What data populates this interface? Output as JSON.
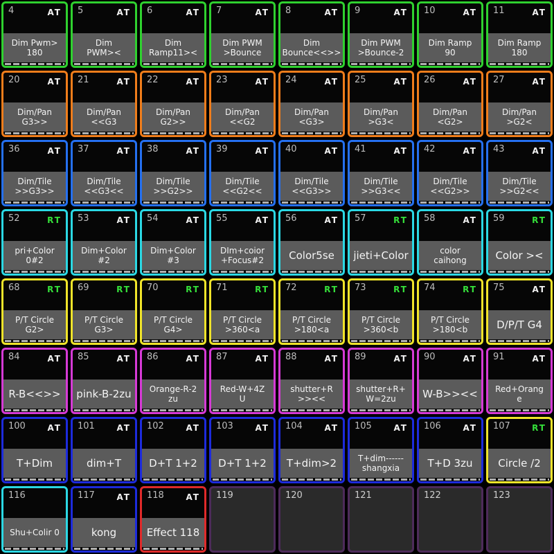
{
  "colors": {
    "green": "#2fd12f",
    "orange": "#f07d1b",
    "blue": "#2570f0",
    "cyan": "#2bd8e4",
    "yellow": "#f0e42a",
    "magenta": "#d63ad6",
    "deepblue": "#1d2bdc",
    "red": "#e02a2a",
    "empty": "#4d2b5a"
  },
  "rows": [
    {
      "color": "green",
      "cells": [
        {
          "num": "4",
          "mode": "AT",
          "label": "Dim Pwm>\n180"
        },
        {
          "num": "5",
          "mode": "AT",
          "label": "Dim\nPWM><"
        },
        {
          "num": "6",
          "mode": "AT",
          "label": "Dim\nRamp11><"
        },
        {
          "num": "7",
          "mode": "AT",
          "label": "Dim PWM\n>Bounce"
        },
        {
          "num": "8",
          "mode": "AT",
          "label": "Dim\nBounce<<>>"
        },
        {
          "num": "9",
          "mode": "AT",
          "label": "Dim PWM\n>Bounce-2"
        },
        {
          "num": "10",
          "mode": "AT",
          "label": "Dim Ramp\n90"
        },
        {
          "num": "11",
          "mode": "AT",
          "label": "Dim Ramp\n180"
        }
      ]
    },
    {
      "color": "orange",
      "cells": [
        {
          "num": "20",
          "mode": "AT",
          "label": "Dim/Pan\nG3>>"
        },
        {
          "num": "21",
          "mode": "AT",
          "label": "Dim/Pan\n<<G3"
        },
        {
          "num": "22",
          "mode": "AT",
          "label": "Dim/Pan\nG2>>"
        },
        {
          "num": "23",
          "mode": "AT",
          "label": "Dim/Pan\n<<G2"
        },
        {
          "num": "24",
          "mode": "AT",
          "label": "Dim/Pan\n<G3>"
        },
        {
          "num": "25",
          "mode": "AT",
          "label": "Dim/Pan\n>G3<"
        },
        {
          "num": "26",
          "mode": "AT",
          "label": "Dim/Pan\n<G2>"
        },
        {
          "num": "27",
          "mode": "AT",
          "label": "Dim/Pan\n>G2<"
        }
      ]
    },
    {
      "color": "blue",
      "cells": [
        {
          "num": "36",
          "mode": "AT",
          "label": "Dim/Tile\n>>G3>>"
        },
        {
          "num": "37",
          "mode": "AT",
          "label": "Dim/Tile\n<<G3<<"
        },
        {
          "num": "38",
          "mode": "AT",
          "label": "Dim/Tile\n>>G2>>"
        },
        {
          "num": "39",
          "mode": "AT",
          "label": "Dim/Tile\n<<G2<<"
        },
        {
          "num": "40",
          "mode": "AT",
          "label": "Dim/Tile\n<<G3>>"
        },
        {
          "num": "41",
          "mode": "AT",
          "label": "Dim/Tile\n>>G3<<"
        },
        {
          "num": "42",
          "mode": "AT",
          "label": "Dim/Tile\n<<G2>>"
        },
        {
          "num": "43",
          "mode": "AT",
          "label": "Dim/Tile\n>>G2<<"
        }
      ]
    },
    {
      "color": "cyan",
      "cells": [
        {
          "num": "52",
          "mode": "RT",
          "label": "pri+Color\n0#2"
        },
        {
          "num": "53",
          "mode": "AT",
          "label": "Dim+Color\n#2"
        },
        {
          "num": "54",
          "mode": "AT",
          "label": "Dim+Color\n#3"
        },
        {
          "num": "55",
          "mode": "AT",
          "label": "DIm+coior\n+Focus#2"
        },
        {
          "num": "56",
          "mode": "AT",
          "label": "Color5se",
          "big": true
        },
        {
          "num": "57",
          "mode": "RT",
          "label": "jieti+Color",
          "big": true
        },
        {
          "num": "58",
          "mode": "AT",
          "label": "color\ncaihong"
        },
        {
          "num": "59",
          "mode": "RT",
          "label": "Color ><",
          "big": true
        }
      ]
    },
    {
      "color": "yellow",
      "cells": [
        {
          "num": "68",
          "mode": "RT",
          "label": "P/T Circle\nG2>"
        },
        {
          "num": "69",
          "mode": "RT",
          "label": "P/T Circle\nG3>"
        },
        {
          "num": "70",
          "mode": "RT",
          "label": "P/T Circle\nG4>"
        },
        {
          "num": "71",
          "mode": "RT",
          "label": "P/T Circle\n>360<a"
        },
        {
          "num": "72",
          "mode": "RT",
          "label": "P/T Circle\n>180<a"
        },
        {
          "num": "73",
          "mode": "RT",
          "label": "P/T Circle\n>360<b"
        },
        {
          "num": "74",
          "mode": "RT",
          "label": "P/T Circle\n>180<b"
        },
        {
          "num": "75",
          "mode": "AT",
          "label": "D/P/T G4",
          "big": true
        }
      ]
    },
    {
      "color": "magenta",
      "cells": [
        {
          "num": "84",
          "mode": "AT",
          "label": "R-B<<>>",
          "big": true
        },
        {
          "num": "85",
          "mode": "AT",
          "label": "pink-B-2zu",
          "big": true
        },
        {
          "num": "86",
          "mode": "AT",
          "label": "Orange-R-2\nzu"
        },
        {
          "num": "87",
          "mode": "AT",
          "label": "Red-W+4Z\nU"
        },
        {
          "num": "88",
          "mode": "AT",
          "label": "shutter+R\n>><<"
        },
        {
          "num": "89",
          "mode": "AT",
          "label": "shutter+R+\nW=2zu"
        },
        {
          "num": "90",
          "mode": "AT",
          "label": "W-B>><<",
          "big": true
        },
        {
          "num": "91",
          "mode": "AT",
          "label": "Red+Orang\ne"
        }
      ]
    },
    {
      "color": "deepblue",
      "cells": [
        {
          "num": "100",
          "mode": "AT",
          "label": "T+Dim",
          "big": true
        },
        {
          "num": "101",
          "mode": "AT",
          "label": "dim+T",
          "big": true
        },
        {
          "num": "102",
          "mode": "AT",
          "label": "D+T  1+2",
          "big": true
        },
        {
          "num": "103",
          "mode": "AT",
          "label": "D+T 1+2",
          "big": true
        },
        {
          "num": "104",
          "mode": "AT",
          "label": "T+dim>2",
          "big": true
        },
        {
          "num": "105",
          "mode": "AT",
          "label": "T+dim------\nshangxia"
        },
        {
          "num": "106",
          "mode": "AT",
          "label": "T+D 3zu",
          "big": true
        },
        {
          "num": "107",
          "mode": "RT",
          "label": "Circle /2",
          "big": true,
          "color": "yellow"
        }
      ]
    },
    {
      "color": "empty",
      "cells": [
        {
          "num": "116",
          "mode": "",
          "label": "Shu+Colir 0",
          "color": "cyan"
        },
        {
          "num": "117",
          "mode": "AT",
          "label": "kong",
          "big": true,
          "color": "deepblue"
        },
        {
          "num": "118",
          "mode": "AT",
          "label": "Effect 118",
          "big": true,
          "color": "red"
        },
        {
          "num": "119",
          "empty": true
        },
        {
          "num": "120",
          "empty": true
        },
        {
          "num": "121",
          "empty": true
        },
        {
          "num": "122",
          "empty": true
        },
        {
          "num": "123",
          "empty": true
        }
      ]
    }
  ]
}
